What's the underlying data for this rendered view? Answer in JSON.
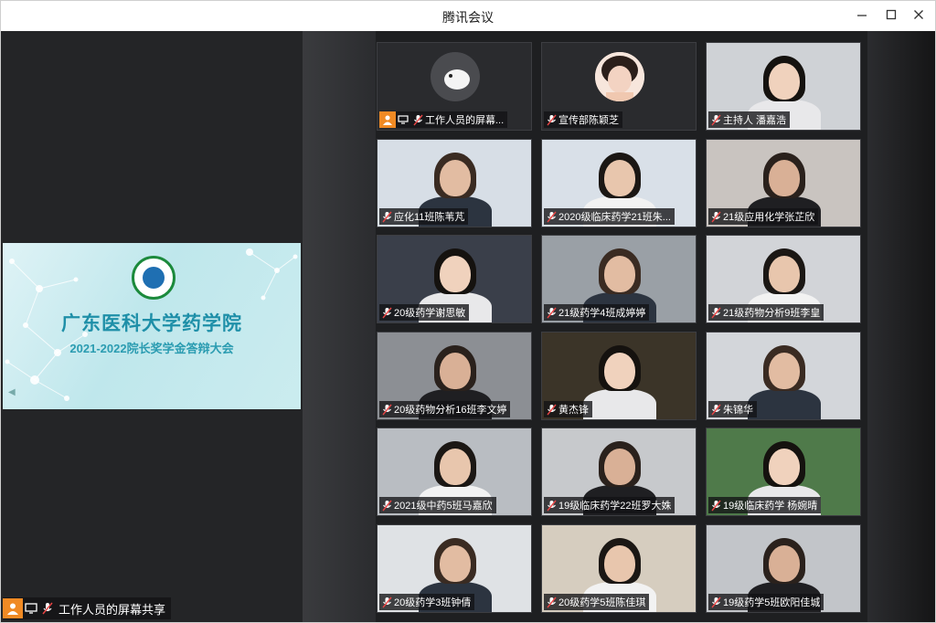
{
  "window": {
    "title": "腾讯会议"
  },
  "share": {
    "slide_title": "广东医科大学药学院",
    "slide_subtitle": "2021-2022院长奖学金答辩大会",
    "presenter_label": "工作人员的屏幕共享"
  },
  "participants": [
    {
      "name": "工作人员的屏幕...",
      "bg": "#2a2b2e",
      "type": "avatar",
      "presenter": true
    },
    {
      "name": "宣传部陈颖芝",
      "bg": "#2a2b2e",
      "type": "avatar"
    },
    {
      "name": "主持人 潘嘉浩",
      "bg": "#cfd2d6",
      "type": "video"
    },
    {
      "name": "应化11班陈苇芃",
      "bg": "#d7dee6",
      "type": "video"
    },
    {
      "name": "2020级临床药学21班朱...",
      "bg": "#d9e0e8",
      "type": "video"
    },
    {
      "name": "21级应用化学张芷欣",
      "bg": "#c9c4c0",
      "type": "video"
    },
    {
      "name": "20级药学谢思敏",
      "bg": "#3a3f4a",
      "type": "video"
    },
    {
      "name": "21级药学4班成婷婷",
      "bg": "#9aa0a6",
      "type": "video"
    },
    {
      "name": "21级药物分析9班李皇",
      "bg": "#d2d4d8",
      "type": "video"
    },
    {
      "name": "20级药物分析16班李文婷",
      "bg": "#8c8f94",
      "type": "video"
    },
    {
      "name": "黄杰锋",
      "bg": "#3b3428",
      "type": "video"
    },
    {
      "name": "朱锦华",
      "bg": "#d3d6da",
      "type": "video"
    },
    {
      "name": "2021级中药5班马嘉欣",
      "bg": "#b9bdc2",
      "type": "video"
    },
    {
      "name": "19级临床药学22班罗大姝",
      "bg": "#c7c9cc",
      "type": "video"
    },
    {
      "name": "19级临床药学 杨婉晴",
      "bg": "#4f7a4a",
      "type": "video"
    },
    {
      "name": "20级药学3班钟倩",
      "bg": "#dfe2e5",
      "type": "video"
    },
    {
      "name": "20级药学5班陈佳琪",
      "bg": "#d6cdbf",
      "type": "video"
    },
    {
      "name": "19级药学5班欧阳佳城",
      "bg": "#c2c5c9",
      "type": "video"
    }
  ]
}
